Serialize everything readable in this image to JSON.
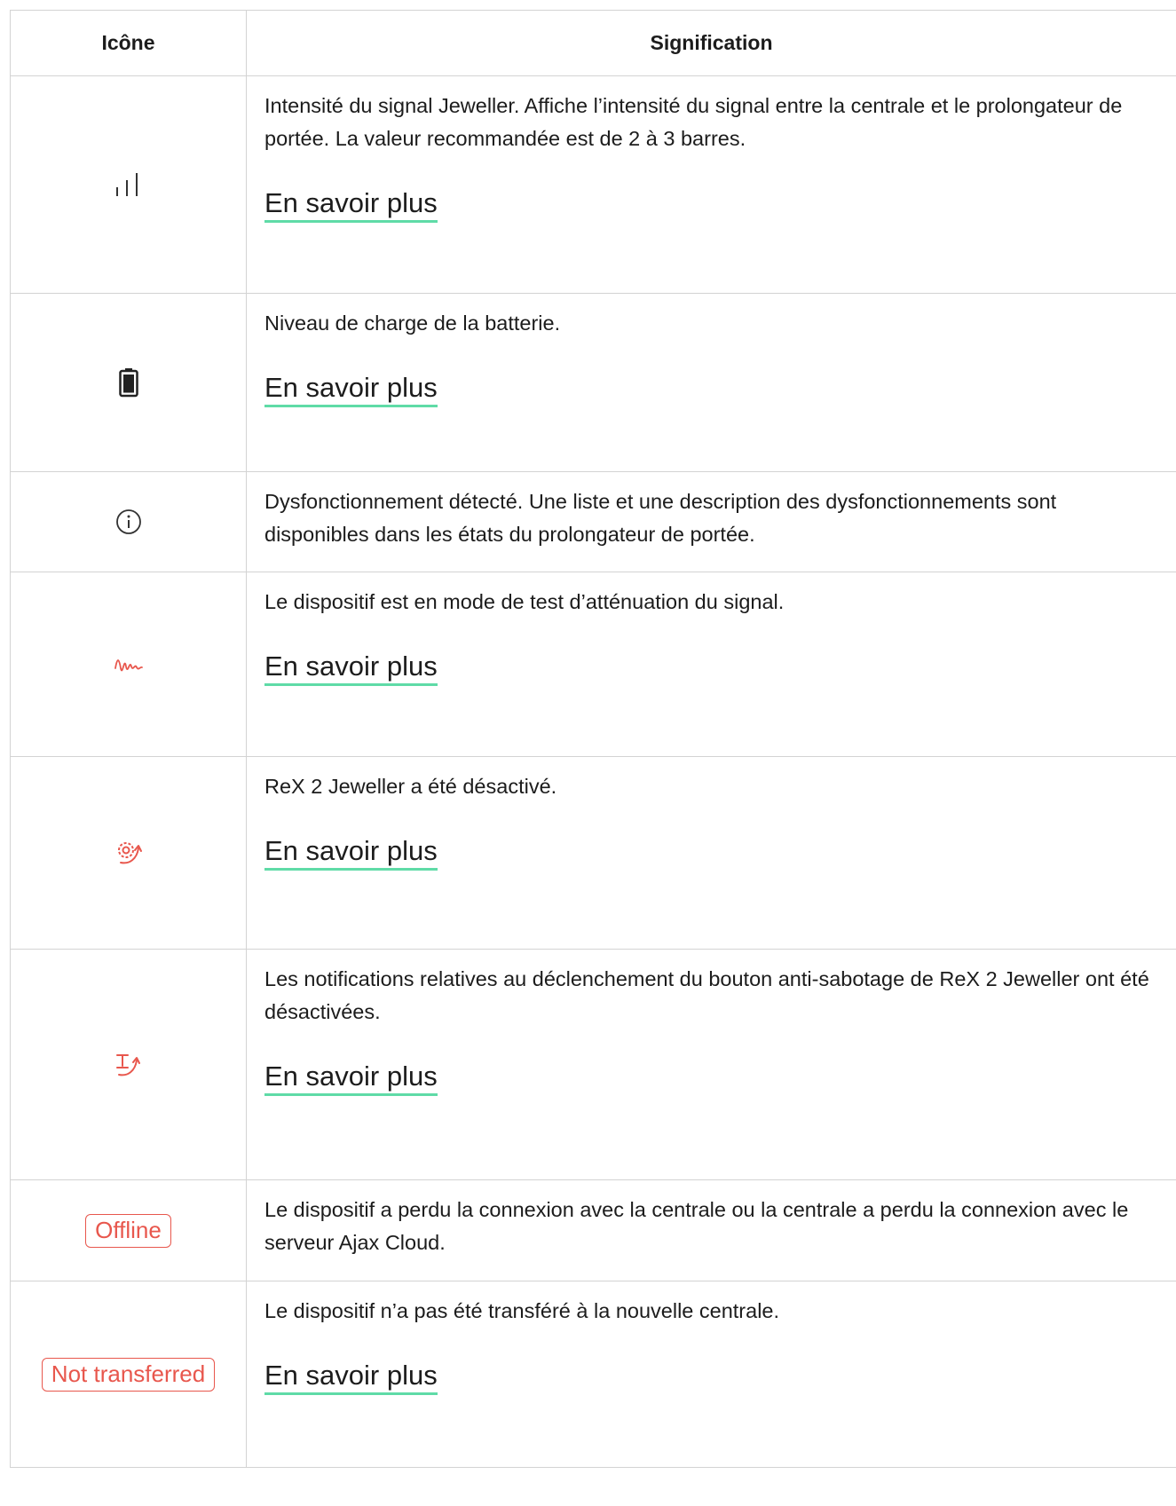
{
  "table": {
    "header": {
      "icon": "Icône",
      "meaning": "Signification"
    },
    "link_label": "En savoir plus",
    "rows": [
      {
        "icon": "signal-bars-icon",
        "text": "Intensité du signal Jeweller. Affiche l’intensité du signal entre la centrale et le prolongateur de portée. La valeur recommandée est de 2 à 3 barres.",
        "link": "En savoir plus"
      },
      {
        "icon": "battery-icon",
        "text": "Niveau de charge de la batterie.",
        "link": "En savoir plus"
      },
      {
        "icon": "info-icon",
        "text": "Dysfonctionnement détecté. Une liste et une description des dysfonctionnements sont disponibles dans les états du prolongateur de portée."
      },
      {
        "icon": "signal-attenuation-icon",
        "text": "Le dispositif est en mode de test d’atténuation du signal.",
        "link": "En savoir plus"
      },
      {
        "icon": "device-deactivated-icon",
        "text": "ReX 2 Jeweller a été désactivé.",
        "link": "En savoir plus"
      },
      {
        "icon": "tamper-notifications-disabled-icon",
        "text": "Les notifications relatives au déclenchement du bouton anti-sabotage de ReX 2 Jeweller ont été désactivées.",
        "link": "En savoir plus"
      },
      {
        "badge": "Offline",
        "text": "Le dispositif a perdu la connexion avec la centrale ou la centrale a perdu la connexion avec le serveur Ajax Cloud."
      },
      {
        "badge": "Not transferred",
        "text": "Le dispositif n’a pas été transféré à la nouvelle centrale.",
        "link": "En savoir plus"
      }
    ]
  },
  "colors": {
    "link_underline": "#5fdba7",
    "alert": "#e8574d",
    "border": "#d3d3d3",
    "text": "#1c1c1c"
  }
}
